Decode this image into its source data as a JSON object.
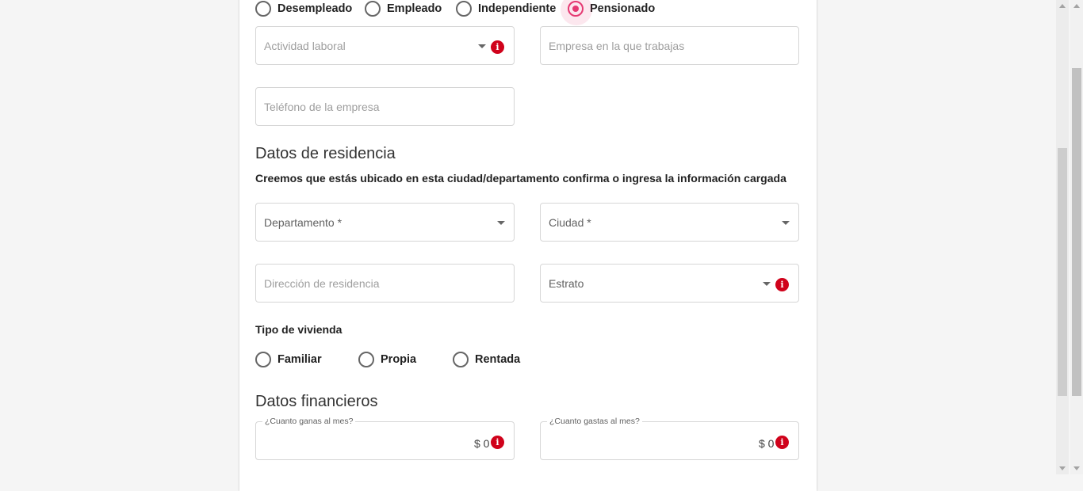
{
  "employment": {
    "options": [
      {
        "label": "Desempleado",
        "checked": false
      },
      {
        "label": "Empleado",
        "checked": false
      },
      {
        "label": "Independiente",
        "checked": false
      },
      {
        "label": "Pensionado",
        "checked": true
      }
    ],
    "activity_placeholder": "Actividad laboral",
    "company_placeholder": "Empresa en la que trabajas",
    "company_phone_placeholder": "Teléfono de la empresa"
  },
  "residence": {
    "title": "Datos de residencia",
    "subtitle": "Creemos que estás ubicado en esta ciudad/departamento confirma o ingresa la información cargada",
    "department_label": "Departamento *",
    "city_label": "Ciudad *",
    "address_placeholder": "Dirección de residencia",
    "stratum_label": "Estrato",
    "housing_type_label": "Tipo de vivienda",
    "housing_options": [
      {
        "label": "Familiar",
        "checked": false
      },
      {
        "label": "Propia",
        "checked": false
      },
      {
        "label": "Rentada",
        "checked": false
      }
    ]
  },
  "financial": {
    "title": "Datos financieros",
    "income_label": "¿Cuanto ganas al mes?",
    "income_value": "$ 0",
    "expenses_label": "¿Cuanto gastas al mes?",
    "expenses_value": "$ 0"
  },
  "icons": {
    "info": "info-icon",
    "dropdown": "caret-down-icon"
  },
  "colors": {
    "accent": "#e53972",
    "info": "#d0021b"
  }
}
